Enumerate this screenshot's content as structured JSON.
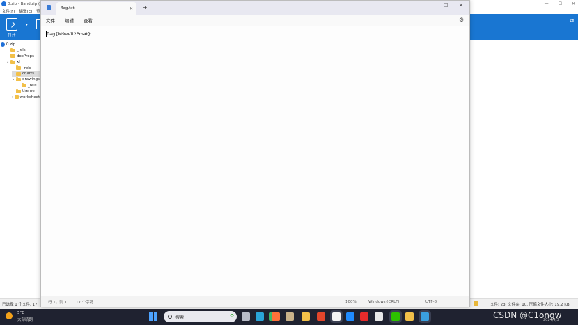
{
  "bandizip": {
    "title": "0.zip - Bandizip (S",
    "menu": [
      "文件(F)",
      "编辑(E)",
      "查"
    ],
    "toolbar": {
      "open_label": "打开",
      "dropdown": "▾"
    },
    "tree": [
      {
        "label": "0.zip",
        "icon": "zip-icon",
        "indent": 0,
        "arrow": "",
        "selected": false
      },
      {
        "label": "_rels",
        "icon": "folder-icon",
        "indent": 1,
        "arrow": "",
        "selected": false
      },
      {
        "label": "docProps",
        "icon": "folder-icon",
        "indent": 1,
        "arrow": "",
        "selected": false
      },
      {
        "label": "xl",
        "icon": "folder-icon",
        "indent": 1,
        "arrow": "⌄",
        "selected": false
      },
      {
        "label": "_rels",
        "icon": "folder-icon",
        "indent": 2,
        "arrow": "",
        "selected": false
      },
      {
        "label": "charts",
        "icon": "folder-icon",
        "indent": 2,
        "arrow": "",
        "selected": true
      },
      {
        "label": "drawings",
        "icon": "folder-icon",
        "indent": 2,
        "arrow": "⌄",
        "selected": false
      },
      {
        "label": "_rels",
        "icon": "folder-icon",
        "indent": 3,
        "arrow": "",
        "selected": false
      },
      {
        "label": "theme",
        "icon": "folder-icon",
        "indent": 2,
        "arrow": "",
        "selected": false
      },
      {
        "label": "worksheets",
        "icon": "folder-icon",
        "indent": 2,
        "arrow": "›",
        "selected": false
      }
    ],
    "status_left": "已选择 1 个文件, 17.",
    "status_right": "文件: 23, 文件夹: 10, 压缩文件大小: 19.2 KB"
  },
  "notepad": {
    "tab_title": "flag.txt",
    "new_tab": "+",
    "window_buttons": {
      "minimize": "—",
      "maximize": "☐",
      "close": "✕"
    },
    "menus": [
      "文件",
      "编辑",
      "查看"
    ],
    "content": "flag{M9eVfi2Pcs#}",
    "status": {
      "position": "行 1，列 1",
      "chars": "17 个字符",
      "zoom": "100%",
      "line_ending": "Windows (CRLF)",
      "encoding": "UTF-8"
    }
  },
  "taskbar": {
    "weather_temp": "5°C",
    "weather_desc": "大部晴朗",
    "search_placeholder": "搜索",
    "watermark": "CSDN @C1ongw",
    "date": "2024/4/3",
    "icons": [
      {
        "name": "taskbar-file-explorer-icon",
        "color": "#b8bcc8",
        "active": false
      },
      {
        "name": "taskbar-terminal-icon",
        "color": "#2aa5d9",
        "active": false
      },
      {
        "name": "taskbar-edge-icon",
        "color": "#3ab86b",
        "active": false
      },
      {
        "name": "taskbar-firefox-icon",
        "color": "#ff7139",
        "active": false
      },
      {
        "name": "taskbar-app-icon",
        "color": "#c9b28a",
        "active": false
      },
      {
        "name": "taskbar-folder-icon",
        "color": "#f2c049",
        "active": false
      },
      {
        "name": "taskbar-flame-icon",
        "color": "#e2462b",
        "active": false
      },
      {
        "name": "taskbar-qq-icon",
        "color": "#f5f5f5",
        "active": true
      },
      {
        "name": "taskbar-arrow-app-icon",
        "color": "#1f8bff",
        "active": false
      },
      {
        "name": "taskbar-wps-icon",
        "color": "#e52b2b",
        "active": false
      },
      {
        "name": "taskbar-bc-icon",
        "color": "#e8e8e8",
        "active": false
      },
      {
        "name": "taskbar-wechat-icon",
        "color": "#2dc100",
        "active": true
      },
      {
        "name": "taskbar-explorer-icon",
        "color": "#f2c049",
        "active": false
      },
      {
        "name": "taskbar-notepad-icon",
        "color": "#3aa0e0",
        "active": true
      }
    ]
  }
}
